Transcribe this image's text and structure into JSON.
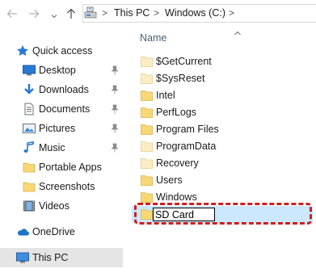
{
  "address_bar": {
    "crumbs": [
      "This PC",
      "Windows (C:)"
    ],
    "separator": ">"
  },
  "navigation": {
    "items": [
      {
        "label": "Quick access",
        "icon": "star-icon",
        "pinned": false
      },
      {
        "label": "Desktop",
        "icon": "desktop-icon",
        "pinned": true
      },
      {
        "label": "Downloads",
        "icon": "download-icon",
        "pinned": true
      },
      {
        "label": "Documents",
        "icon": "documents-icon",
        "pinned": true
      },
      {
        "label": "Pictures",
        "icon": "pictures-icon",
        "pinned": true
      },
      {
        "label": "Music",
        "icon": "music-icon",
        "pinned": true
      },
      {
        "label": "Portable Apps",
        "icon": "folder-icon",
        "pinned": false
      },
      {
        "label": "Screenshots",
        "icon": "folder-icon",
        "pinned": false
      },
      {
        "label": "Videos",
        "icon": "videos-icon",
        "pinned": false
      },
      {
        "label": "OneDrive",
        "icon": "cloud-icon",
        "pinned": false
      },
      {
        "label": "This PC",
        "icon": "computer-icon",
        "pinned": false,
        "selected": true
      }
    ]
  },
  "content": {
    "column_header": "Name",
    "files": [
      {
        "name": "$GetCurrent",
        "style": "light"
      },
      {
        "name": "$SysReset",
        "style": "light"
      },
      {
        "name": "Intel",
        "style": "normal"
      },
      {
        "name": "PerfLogs",
        "style": "normal"
      },
      {
        "name": "Program Files",
        "style": "normal"
      },
      {
        "name": "ProgramData",
        "style": "light"
      },
      {
        "name": "Recovery",
        "style": "light"
      },
      {
        "name": "Users",
        "style": "normal"
      },
      {
        "name": "Windows",
        "style": "normal"
      }
    ],
    "new_folder": {
      "value": "SD Card"
    }
  },
  "colors": {
    "folder": "#f8d775",
    "folder_light": "#fbeec6",
    "selection": "#cce8ff",
    "highlight_dash": "#cc1f1f",
    "header_text": "#4c607a"
  }
}
